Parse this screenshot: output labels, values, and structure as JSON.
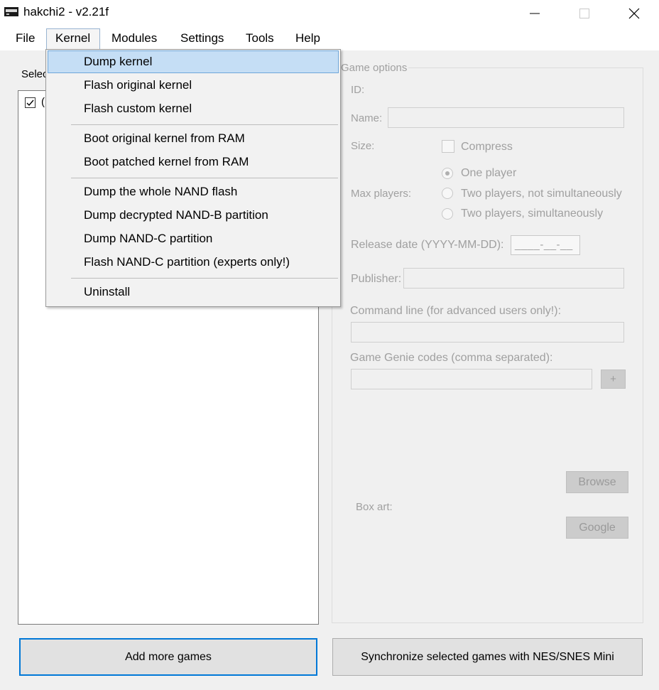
{
  "window": {
    "title": "hakchi2 - v2.21f"
  },
  "menubar": {
    "items": [
      "File",
      "Kernel",
      "Modules",
      "Settings",
      "Tools",
      "Help"
    ]
  },
  "kernel_menu": {
    "items": [
      "Dump kernel",
      "Flash original kernel",
      "Flash custom kernel",
      "Boot original kernel from RAM",
      "Boot patched kernel from RAM",
      "Dump the whole NAND flash",
      "Dump decrypted NAND-B partition",
      "Dump NAND-C partition",
      "Flash NAND-C partition (experts only!)",
      "Uninstall"
    ],
    "highlighted": "Dump kernel"
  },
  "left_panel": {
    "select_label_visible": "Selec",
    "first_game_prefix": "("
  },
  "game_options": {
    "legend": "Game options",
    "id_label": "ID:",
    "name_label": "Name:",
    "size_label": "Size:",
    "compress_label": "Compress",
    "max_players_label": "Max players:",
    "player_options": [
      "One player",
      "Two players, not simultaneously",
      "Two players, simultaneously"
    ],
    "release_date_label": "Release date (YYYY-MM-DD):",
    "release_date_value": "____-__-__",
    "publisher_label": "Publisher:",
    "command_line_label": "Command line (for advanced users only!):",
    "game_genie_label": "Game Genie codes (comma separated):",
    "add_code_button": "+",
    "box_art_label": "Box art:",
    "browse_button": "Browse",
    "google_button": "Google"
  },
  "buttons": {
    "add_games": "Add more games",
    "sync": "Synchronize selected games with NES/SNES Mini"
  }
}
